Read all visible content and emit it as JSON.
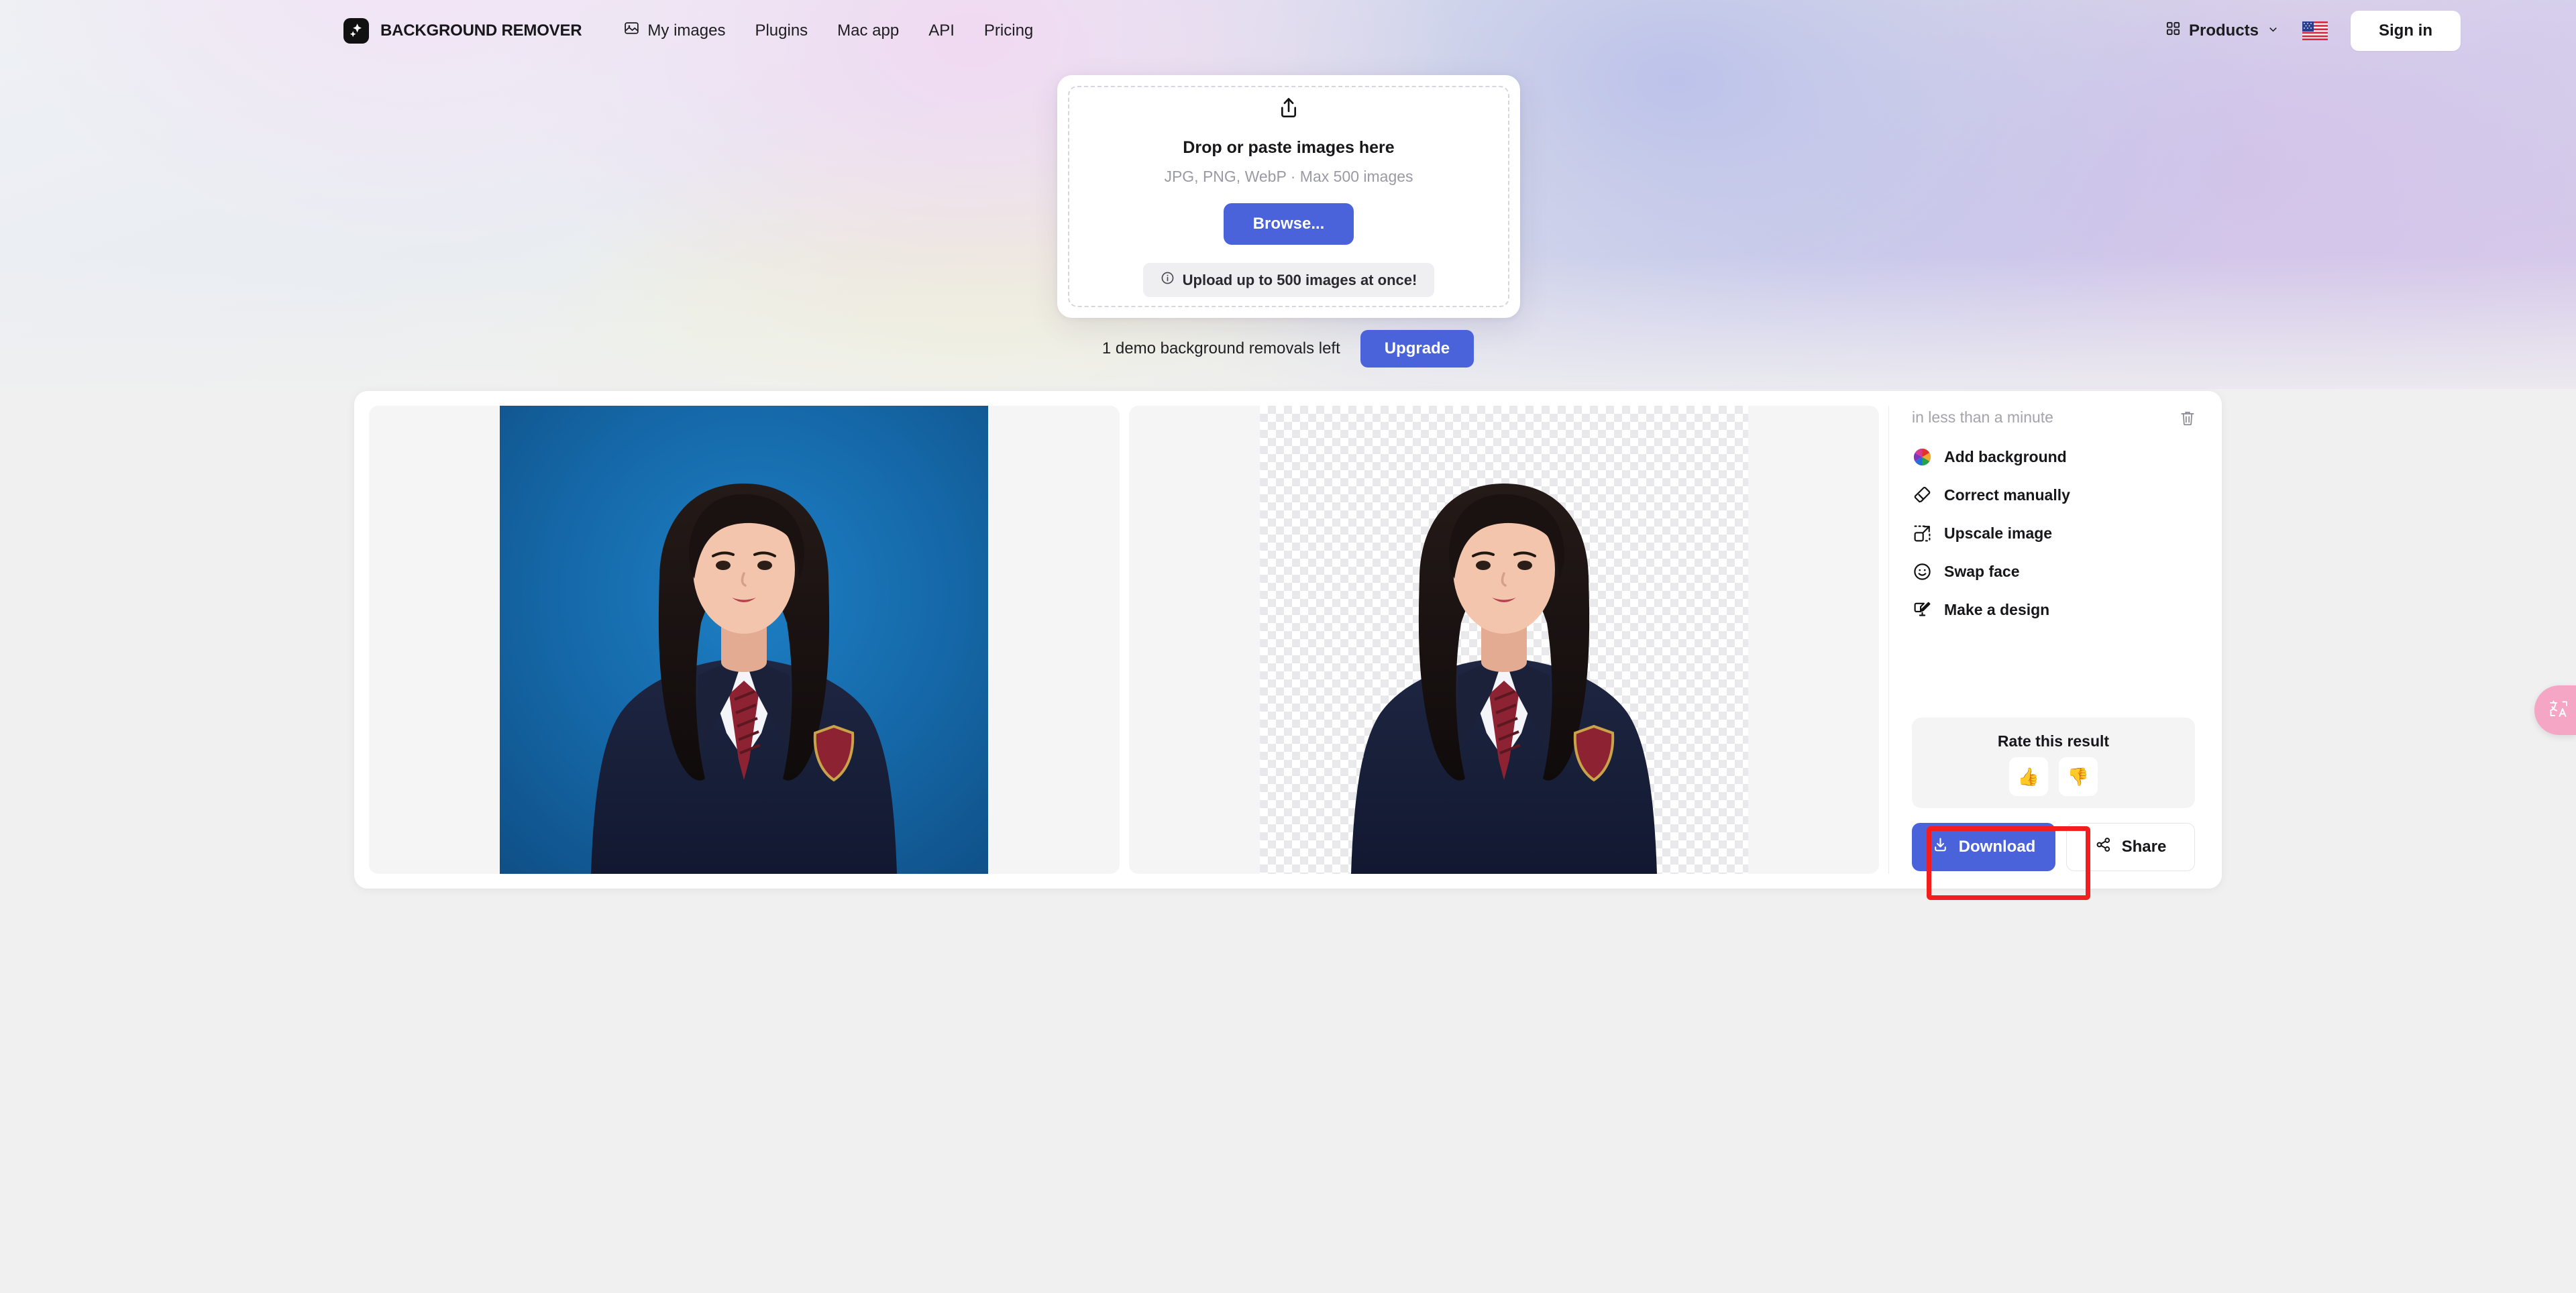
{
  "header": {
    "brand": {
      "name": "BACKGROUND REMOVER",
      "icon": "sparkle-logo-icon"
    },
    "nav": [
      {
        "label": "My images",
        "icon": "image-stack-icon"
      },
      {
        "label": "Plugins",
        "icon": ""
      },
      {
        "label": "Mac app",
        "icon": ""
      },
      {
        "label": "API",
        "icon": ""
      },
      {
        "label": "Pricing",
        "icon": ""
      }
    ],
    "products": {
      "label": "Products",
      "icon": "grid-icon",
      "chevron": "chevron-down-icon"
    },
    "language": {
      "icon": "us-flag-icon",
      "alt": "English (US)"
    },
    "sign_in": "Sign in"
  },
  "upload": {
    "icon": "share-upload-icon",
    "title": "Drop or paste images here",
    "subtitle": "JPG, PNG, WebP · Max 500 images",
    "browse_label": "Browse...",
    "note": "Upload up to 500 images at once!",
    "note_icon": "info-circle-icon"
  },
  "demo": {
    "text": "1 demo background removals left",
    "upgrade_label": "Upgrade"
  },
  "result": {
    "status": "in less than a minute",
    "delete_icon": "trash-icon",
    "actions": [
      {
        "label": "Add background",
        "icon": "color-wheel-icon"
      },
      {
        "label": "Correct manually",
        "icon": "eraser-icon"
      },
      {
        "label": "Upscale image",
        "icon": "upscale-arrow-icon"
      },
      {
        "label": "Swap face",
        "icon": "smiley-face-icon"
      },
      {
        "label": "Make a design",
        "icon": "design-monitor-icon"
      }
    ],
    "rate": {
      "title": "Rate this result",
      "thumbs_up": "👍",
      "thumbs_down": "👎"
    },
    "download_label": "Download",
    "download_icon": "download-arrow-icon",
    "share_label": "Share",
    "share_icon": "share-nodes-icon",
    "original_alt": "Portrait on blue background",
    "result_alt": "Portrait with transparent background"
  },
  "translate_widget": {
    "icon": "translate-icon",
    "label": "中A"
  },
  "colors": {
    "accent": "#4a63da",
    "highlight": "#f41c1c",
    "panel_bg": "#f5f5f5",
    "page_bg": "#f0f0f0",
    "widget_pink": "#f4a6c4"
  }
}
